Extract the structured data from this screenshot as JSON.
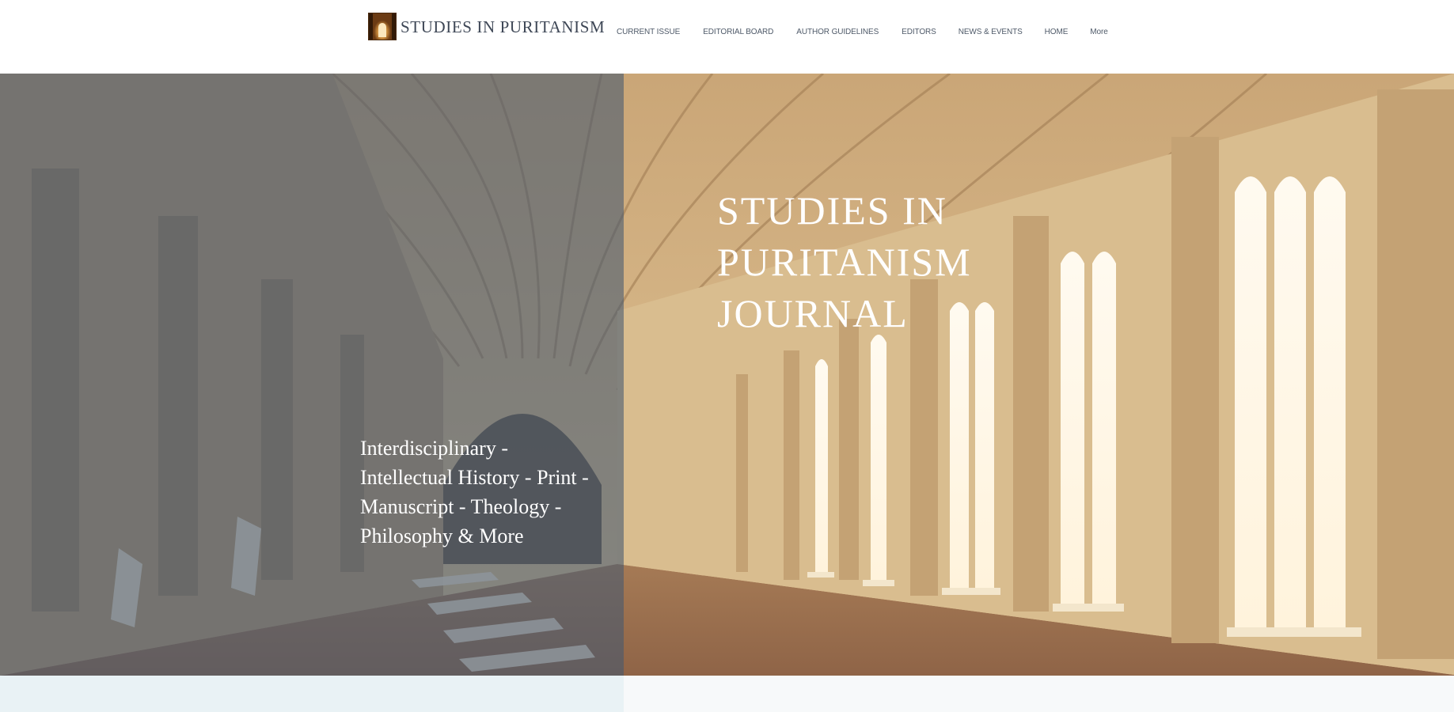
{
  "header": {
    "site_title": "STUDIES IN PURITANISM",
    "nav": [
      {
        "label": "CURRENT ISSUE"
      },
      {
        "label": "EDITORIAL BOARD"
      },
      {
        "label": "AUTHOR GUIDELINES"
      },
      {
        "label": "EDITORS"
      },
      {
        "label": "NEWS & EVENTS"
      },
      {
        "label": "HOME"
      },
      {
        "label": "More"
      }
    ]
  },
  "hero": {
    "heading": "STUDIES IN\nPURITANISM\nJOURNAL",
    "tagline": "Interdisciplinary -\nIntellectual History - Print -\nManuscript - Theology -\nPhilosophy  &  More"
  },
  "colors": {
    "overlay": "#44586f",
    "text_dark": "#3e4756",
    "band_left": "#e9f2f5"
  }
}
